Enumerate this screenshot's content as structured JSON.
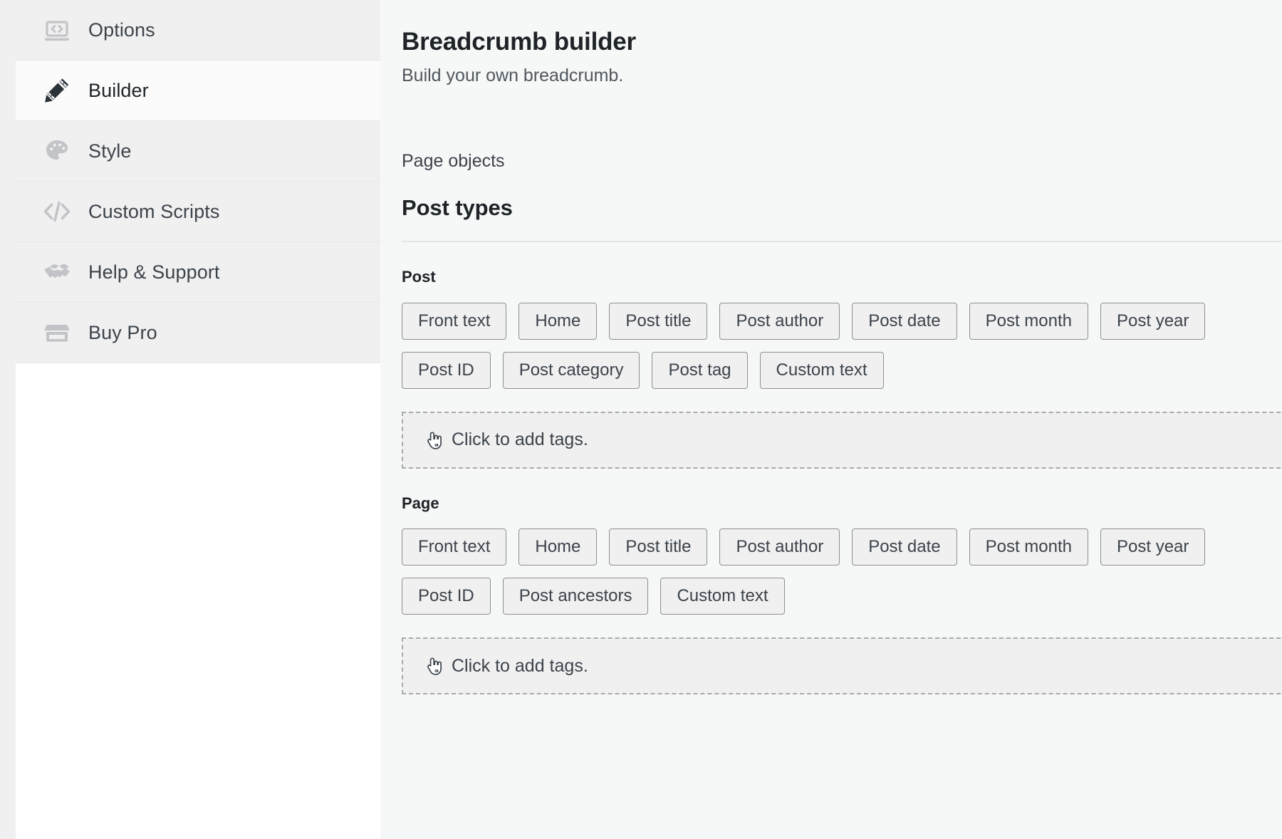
{
  "sidebar": {
    "items": [
      {
        "label": "Options",
        "icon": "laptop-code-icon",
        "active": false
      },
      {
        "label": "Builder",
        "icon": "pencil-ruler-icon",
        "active": true
      },
      {
        "label": "Style",
        "icon": "palette-icon",
        "active": false
      },
      {
        "label": "Custom Scripts",
        "icon": "code-brackets-icon",
        "active": false
      },
      {
        "label": "Help & Support",
        "icon": "handshake-icon",
        "active": false
      },
      {
        "label": "Buy Pro",
        "icon": "store-icon",
        "active": false
      }
    ]
  },
  "header": {
    "title": "Breadcrumb builder",
    "subtitle": "Build your own breadcrumb."
  },
  "main": {
    "eyebrow": "Page objects",
    "section_title": "Post types",
    "groups": [
      {
        "title": "Post",
        "tags": [
          "Front text",
          "Home",
          "Post title",
          "Post author",
          "Post date",
          "Post month",
          "Post year",
          "Post ID",
          "Post category",
          "Post tag",
          "Custom text"
        ],
        "dropzone": {
          "text": "Click to add tags.",
          "icon": "hand-pointer-icon"
        }
      },
      {
        "title": "Page",
        "tags": [
          "Front text",
          "Home",
          "Post title",
          "Post author",
          "Post date",
          "Post month",
          "Post year",
          "Post ID",
          "Post ancestors",
          "Custom text"
        ],
        "dropzone": {
          "text": "Click to add tags.",
          "icon": "hand-pointer-icon"
        }
      }
    ]
  },
  "colors": {
    "page_background": "#f0f0f1",
    "content_background": "#f6f7f7",
    "sidebar_active": "#fbfbfc",
    "text_primary": "#1d2327",
    "text_secondary": "#50575e",
    "button_border": "#8c8f94",
    "dropzone_border": "#a7aaad"
  }
}
